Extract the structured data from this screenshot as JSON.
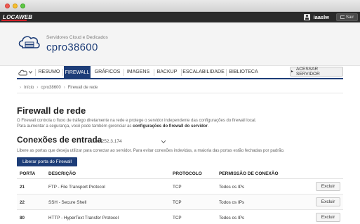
{
  "topbar": {
    "brand": "LOCAWEB",
    "user_name": "iaaslw",
    "logout_label": "Sair"
  },
  "header": {
    "subtitle": "Servidores Cloud e Dedicados",
    "server_name": "cpro38600"
  },
  "nav": {
    "items": [
      {
        "label": "RESUMO"
      },
      {
        "label": "FIREWALL"
      },
      {
        "label": "GRÁFICOS"
      },
      {
        "label": "IMAGENS"
      },
      {
        "label": "BACKUP"
      },
      {
        "label": "ESCALABILIDADE"
      },
      {
        "label": "BIBLIOTECA"
      }
    ],
    "access_button": "ACESSAR SERVIDOR"
  },
  "breadcrumb": [
    "Início",
    "cpro38600",
    "Firewall de rede"
  ],
  "page": {
    "title": "Firewall de rede",
    "description_line1": "O Firewall controla o fluxo de tráfego diretamente na rede e protege o servidor independente das configurações do firewall local.",
    "description_line2_prefix": "Para aumentar a segurança, você pode também gerenciar as",
    "description_line2_link": "configurações do firewall do servidor",
    "description_line2_suffix": ".",
    "section_title": "Conexões de entrada",
    "ip_selected": "191.252.3.174",
    "ports_note": "Libere as portas que deseja utilizar para conectar ao servidor. Para evitar conexões indevidas, a maioria das portas estão fechadas por padrão.",
    "add_button": "Liberar porta do Firewall"
  },
  "table": {
    "headers": {
      "port": "PORTA",
      "description": "DESCRIÇÃO",
      "protocol": "PROTOCOLO",
      "permission": "PERMISSÃO DE CONEXÃO"
    },
    "rows": [
      {
        "port": "21",
        "description": "FTP - File Transport Protocol",
        "protocol": "TCP",
        "permission": "Todos os IPs",
        "action": "Excluir"
      },
      {
        "port": "22",
        "description": "SSH - Secure Shell",
        "protocol": "TCP",
        "permission": "Todos os IPs",
        "action": "Excluir"
      },
      {
        "port": "80",
        "description": "HTTP - HyperText Transfer Protocol",
        "protocol": "TCP",
        "permission": "Todos os IPs",
        "action": "Excluir"
      }
    ]
  },
  "colors": {
    "accent": "#1d3d78",
    "brand_red": "#cf2027",
    "topbar": "#2a2a2a"
  }
}
